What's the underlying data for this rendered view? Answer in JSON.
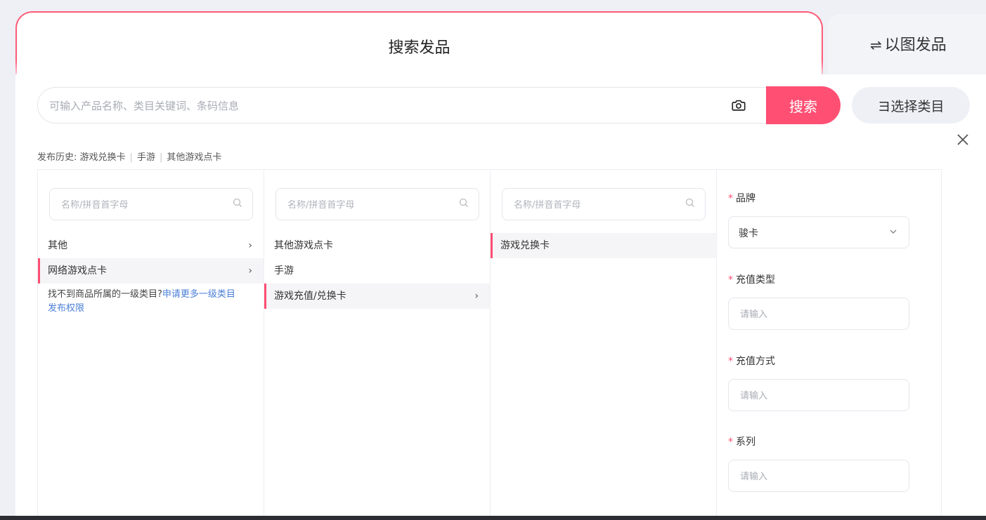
{
  "tabs": {
    "search_publish": "搜索发品",
    "image_publish": "以图发品",
    "image_publish_icon": "swap-icon"
  },
  "search": {
    "placeholder": "可输入产品名称、类目关键词、条码信息",
    "button_label": "搜索",
    "category_button_label": "选择类目",
    "category_button_glyph": "ヨ"
  },
  "history": {
    "label": "发布历史:",
    "items": [
      "游戏兑换卡",
      "手游",
      "其他游戏点卡"
    ]
  },
  "columns": [
    {
      "search_placeholder": "名称/拼音首字母",
      "items": [
        {
          "label": "其他",
          "has_children": true,
          "active": false
        },
        {
          "label": "网络游戏点卡",
          "has_children": true,
          "active": true
        }
      ],
      "hint_text": "找不到商品所属的一级类目?",
      "hint_link": "申请更多一级类目发布权限"
    },
    {
      "search_placeholder": "名称/拼音首字母",
      "items": [
        {
          "label": "其他游戏点卡",
          "has_children": false,
          "active": false
        },
        {
          "label": "手游",
          "has_children": false,
          "active": false
        },
        {
          "label": "游戏充值/兑换卡",
          "has_children": true,
          "active": true
        }
      ]
    },
    {
      "search_placeholder": "名称/拼音首字母",
      "items": [
        {
          "label": "游戏兑换卡",
          "has_children": false,
          "active": true
        }
      ]
    }
  ],
  "form": {
    "brand_label": "品牌",
    "brand_value": "骏卡",
    "recharge_type_label": "充值类型",
    "recharge_method_label": "充值方式",
    "series_label": "系列",
    "input_placeholder": "请输入",
    "required_mark": "*"
  },
  "colors": {
    "accent": "#ff4f73",
    "link": "#4a7fd6",
    "page_bg": "#eef0f6"
  }
}
